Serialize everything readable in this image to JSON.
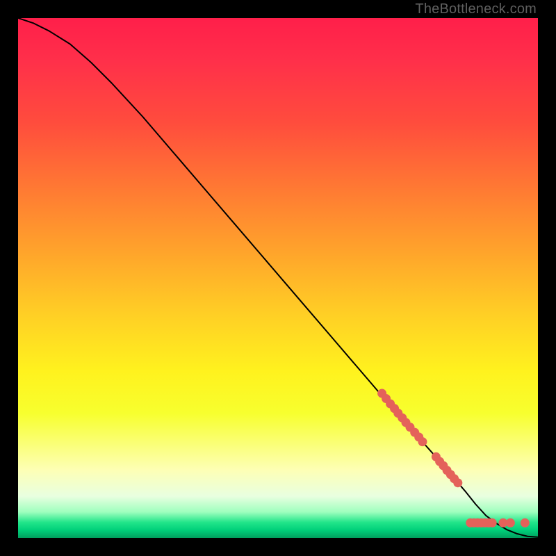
{
  "watermark": "TheBottleneck.com",
  "chart_data": {
    "type": "line",
    "title": "",
    "xlabel": "",
    "ylabel": "",
    "xlim": [
      0,
      100
    ],
    "ylim": [
      0,
      100
    ],
    "series": [
      {
        "name": "curve",
        "color": "#000000",
        "stroke_width": 2,
        "x": [
          0,
          3,
          6,
          10,
          14,
          18,
          24,
          30,
          36,
          42,
          48,
          54,
          60,
          66,
          72,
          76,
          80,
          83,
          86,
          88,
          90,
          92,
          94,
          96,
          98,
          100
        ],
        "y": [
          100,
          99,
          97.5,
          95,
          91.5,
          87.5,
          81,
          74,
          67,
          60,
          53,
          46,
          39,
          32,
          25,
          20.5,
          16,
          12.5,
          9,
          6.5,
          4.3,
          2.8,
          1.6,
          0.8,
          0.3,
          0.15
        ]
      },
      {
        "name": "scatter-points",
        "color": "#e4625a",
        "marker_radius": 6.5,
        "points": [
          {
            "x": 70.0,
            "y": 27.8
          },
          {
            "x": 70.8,
            "y": 26.8
          },
          {
            "x": 71.6,
            "y": 25.8
          },
          {
            "x": 72.4,
            "y": 24.9
          },
          {
            "x": 73.1,
            "y": 24.0
          },
          {
            "x": 73.9,
            "y": 23.1
          },
          {
            "x": 74.6,
            "y": 22.2
          },
          {
            "x": 75.4,
            "y": 21.3
          },
          {
            "x": 76.3,
            "y": 20.3
          },
          {
            "x": 77.1,
            "y": 19.4
          },
          {
            "x": 77.8,
            "y": 18.5
          },
          {
            "x": 80.4,
            "y": 15.6
          },
          {
            "x": 81.1,
            "y": 14.7
          },
          {
            "x": 81.8,
            "y": 13.9
          },
          {
            "x": 82.5,
            "y": 13.0
          },
          {
            "x": 83.2,
            "y": 12.2
          },
          {
            "x": 83.9,
            "y": 11.4
          },
          {
            "x": 84.6,
            "y": 10.6
          },
          {
            "x": 87.0,
            "y": 2.9
          },
          {
            "x": 87.7,
            "y": 2.9
          },
          {
            "x": 88.4,
            "y": 2.9
          },
          {
            "x": 89.1,
            "y": 2.9
          },
          {
            "x": 89.8,
            "y": 2.9
          },
          {
            "x": 90.5,
            "y": 2.9
          },
          {
            "x": 91.2,
            "y": 2.9
          },
          {
            "x": 93.3,
            "y": 2.9
          },
          {
            "x": 94.7,
            "y": 2.9
          },
          {
            "x": 97.5,
            "y": 2.9
          }
        ]
      }
    ]
  }
}
